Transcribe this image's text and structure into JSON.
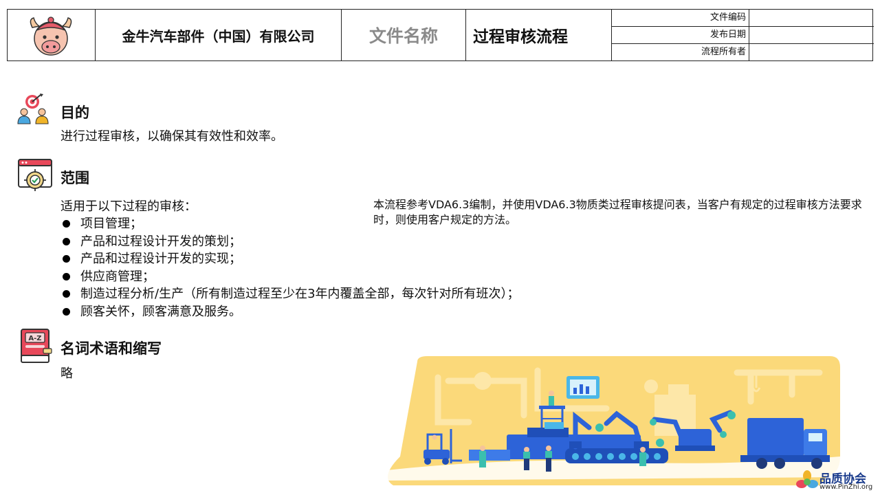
{
  "header": {
    "company": "金牛汽车部件（中国）有限公司",
    "doc_name_label": "文件名称",
    "doc_name": "过程审核流程",
    "meta": [
      {
        "label": "文件编码",
        "value": ""
      },
      {
        "label": "发布日期",
        "value": ""
      },
      {
        "label": "流程所有者",
        "value": ""
      }
    ]
  },
  "purpose": {
    "title": "目的",
    "text": "进行过程审核，以确保其有效性和效率。"
  },
  "scope": {
    "title": "范围",
    "intro": "适用于以下过程的审核：",
    "items": [
      "项目管理；",
      "产品和过程设计开发的策划；",
      "产品和过程设计开发的实现；",
      "供应商管理；",
      "制造过程分析/生产（所有制造过程至少在3年内覆盖全部，每次针对所有班次）；",
      "顾客关怀，顾客满意及服务。"
    ],
    "note": "本流程参考VDA6.3编制，并使用VDA6.3物质类过程审核提问表，当客户有规定的过程审核方法要求时，则使用客户规定的方法。"
  },
  "terms": {
    "title": "名词术语和缩写",
    "text": "略",
    "icon_text": "A-Z"
  },
  "watermark": {
    "name": "品质协会",
    "url": "www.PinZhi.org"
  },
  "colors": {
    "illustration_yellow": "#fbd97a",
    "machine_blue": "#2d63d8",
    "brand_blue": "#1a3b8c"
  },
  "icons": {
    "logo": "bull-mascot-icon",
    "purpose": "target-team-icon",
    "scope": "browser-target-icon",
    "terms": "dictionary-book-icon"
  }
}
